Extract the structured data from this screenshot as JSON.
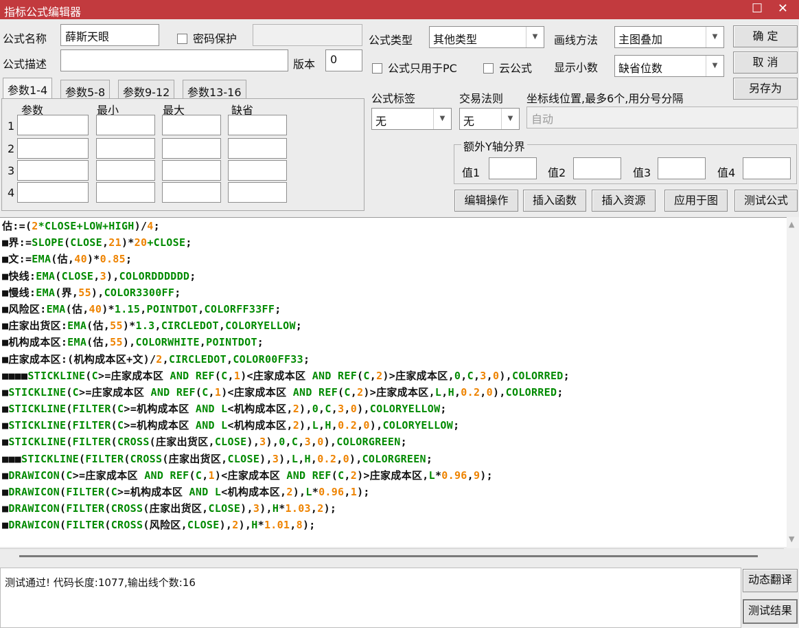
{
  "window": {
    "title": "指标公式编辑器",
    "controls": "☐ ✕"
  },
  "form": {
    "name_label": "公式名称",
    "name_value": "薛斯天眼",
    "password_label": "密码保护",
    "type_label": "公式类型",
    "type_value": "其他类型",
    "draw_label": "画线方法",
    "draw_value": "主图叠加",
    "desc_label": "公式描述",
    "desc_value": "",
    "version_label": "版本",
    "version_value": "0",
    "pc_only_label": "公式只用于PC",
    "cloud_label": "云公式",
    "decimals_label": "显示小数",
    "decimals_value": "缺省位数",
    "tag_label": "公式标签",
    "tag_value": "无",
    "rule_label": "交易法则",
    "rule_value": "无",
    "coord_label": "坐标线位置,最多6个,用分号分隔",
    "coord_placeholder": "自动",
    "yaxis_group": "额外Y轴分界",
    "y1": "值1",
    "y2": "值2",
    "y3": "值3",
    "y4": "值4"
  },
  "buttons": {
    "ok": "确  定",
    "cancel": "取  消",
    "save_as": "另存为",
    "edit_ops": "编辑操作",
    "insert_func": "插入函数",
    "insert_res": "插入资源",
    "apply": "应用于图",
    "test": "测试公式",
    "translate": "动态翻译",
    "test_result": "测试结果"
  },
  "tabs": [
    "参数1-4",
    "参数5-8",
    "参数9-12",
    "参数13-16"
  ],
  "params": {
    "headers": [
      "参数",
      "最小",
      "最大",
      "缺省"
    ],
    "rows": [
      "1",
      "2",
      "3",
      "4"
    ]
  },
  "code": [
    [
      [
        "b",
        "估:=("
      ],
      [
        "n",
        "2"
      ],
      [
        "k",
        "*CLOSE+LOW+HIGH"
      ],
      [
        "b",
        ")/"
      ],
      [
        "n",
        "4"
      ],
      [
        "b",
        ";"
      ]
    ],
    [
      [
        "b",
        "■界:="
      ],
      [
        "k",
        "SLOPE"
      ],
      [
        "b",
        "("
      ],
      [
        "k",
        "CLOSE"
      ],
      [
        "b",
        ","
      ],
      [
        "n",
        "21"
      ],
      [
        "b",
        ")*"
      ],
      [
        "n",
        "20"
      ],
      [
        "k",
        "+CLOSE"
      ],
      [
        "b",
        ";"
      ]
    ],
    [
      [
        "b",
        "■文:="
      ],
      [
        "k",
        "EMA"
      ],
      [
        "b",
        "(估,"
      ],
      [
        "n",
        "40"
      ],
      [
        "b",
        ")*"
      ],
      [
        "n",
        "0.85"
      ],
      [
        "b",
        ";"
      ]
    ],
    [
      [
        "b",
        "■快线:"
      ],
      [
        "k",
        "EMA"
      ],
      [
        "b",
        "("
      ],
      [
        "k",
        "CLOSE"
      ],
      [
        "b",
        ","
      ],
      [
        "n",
        "3"
      ],
      [
        "b",
        "),"
      ],
      [
        "k",
        "COLORDDDDDD"
      ],
      [
        "b",
        ";"
      ]
    ],
    [
      [
        "b",
        "■慢线:"
      ],
      [
        "k",
        "EMA"
      ],
      [
        "b",
        "(界,"
      ],
      [
        "n",
        "55"
      ],
      [
        "b",
        "),"
      ],
      [
        "k",
        "COLOR3300FF"
      ],
      [
        "b",
        ";"
      ]
    ],
    [
      [
        "b",
        "■风险区:"
      ],
      [
        "k",
        "EMA"
      ],
      [
        "b",
        "(估,"
      ],
      [
        "n",
        "40"
      ],
      [
        "b",
        ")*"
      ],
      [
        "k",
        "1.15"
      ],
      [
        "b",
        ","
      ],
      [
        "k",
        "POINTDOT"
      ],
      [
        "b",
        ","
      ],
      [
        "k",
        "COLORFF33FF"
      ],
      [
        "b",
        ";"
      ]
    ],
    [
      [
        "b",
        "■庄家出货区:"
      ],
      [
        "k",
        "EMA"
      ],
      [
        "b",
        "(估,"
      ],
      [
        "n",
        "55"
      ],
      [
        "b",
        ")*"
      ],
      [
        "k",
        "1.3"
      ],
      [
        "b",
        ","
      ],
      [
        "k",
        "CIRCLEDOT"
      ],
      [
        "b",
        ","
      ],
      [
        "k",
        "COLORYELLOW"
      ],
      [
        "b",
        ";"
      ]
    ],
    [
      [
        "b",
        "■机构成本区:"
      ],
      [
        "k",
        "EMA"
      ],
      [
        "b",
        "(估,"
      ],
      [
        "n",
        "55"
      ],
      [
        "b",
        "),"
      ],
      [
        "k",
        "COLORWHITE"
      ],
      [
        "b",
        ","
      ],
      [
        "k",
        "POINTDOT"
      ],
      [
        "b",
        ";"
      ]
    ],
    [
      [
        "b",
        "■庄家成本区:(机构成本区+文)/"
      ],
      [
        "n",
        "2"
      ],
      [
        "b",
        ","
      ],
      [
        "k",
        "CIRCLEDOT"
      ],
      [
        "b",
        ","
      ],
      [
        "k",
        "COLOR00FF33"
      ],
      [
        "b",
        ";"
      ]
    ],
    [
      [
        "b",
        "■■■■"
      ],
      [
        "k",
        "STICKLINE"
      ],
      [
        "b",
        "("
      ],
      [
        "k",
        "C"
      ],
      [
        "b",
        ">=庄家成本区 "
      ],
      [
        "k",
        "AND REF"
      ],
      [
        "b",
        "("
      ],
      [
        "k",
        "C"
      ],
      [
        "b",
        ","
      ],
      [
        "n",
        "1"
      ],
      [
        "b",
        ")<庄家成本区 "
      ],
      [
        "k",
        "AND REF"
      ],
      [
        "b",
        "("
      ],
      [
        "k",
        "C"
      ],
      [
        "b",
        ","
      ],
      [
        "n",
        "2"
      ],
      [
        "b",
        ")>庄家成本区,"
      ],
      [
        "k",
        "0"
      ],
      [
        "b",
        ","
      ],
      [
        "k",
        "C"
      ],
      [
        "b",
        ","
      ],
      [
        "n",
        "3"
      ],
      [
        "b",
        ","
      ],
      [
        "n",
        "0"
      ],
      [
        "b",
        "),"
      ],
      [
        "k",
        "COLORRED"
      ],
      [
        "b",
        ";"
      ]
    ],
    [
      [
        "b",
        "■"
      ],
      [
        "k",
        "STICKLINE"
      ],
      [
        "b",
        "("
      ],
      [
        "k",
        "C"
      ],
      [
        "b",
        ">=庄家成本区 "
      ],
      [
        "k",
        "AND REF"
      ],
      [
        "b",
        "("
      ],
      [
        "k",
        "C"
      ],
      [
        "b",
        ","
      ],
      [
        "n",
        "1"
      ],
      [
        "b",
        ")<庄家成本区 "
      ],
      [
        "k",
        "AND REF"
      ],
      [
        "b",
        "("
      ],
      [
        "k",
        "C"
      ],
      [
        "b",
        ","
      ],
      [
        "n",
        "2"
      ],
      [
        "b",
        ")>庄家成本区,"
      ],
      [
        "k",
        "L"
      ],
      [
        "b",
        ","
      ],
      [
        "k",
        "H"
      ],
      [
        "b",
        ","
      ],
      [
        "n",
        "0.2"
      ],
      [
        "b",
        ","
      ],
      [
        "n",
        "0"
      ],
      [
        "b",
        "),"
      ],
      [
        "k",
        "COLORRED"
      ],
      [
        "b",
        ";"
      ]
    ],
    [
      [
        "b",
        "■"
      ],
      [
        "k",
        "STICKLINE"
      ],
      [
        "b",
        "("
      ],
      [
        "k",
        "FILTER"
      ],
      [
        "b",
        "("
      ],
      [
        "k",
        "C"
      ],
      [
        "b",
        ">=机构成本区 "
      ],
      [
        "k",
        "AND L"
      ],
      [
        "b",
        "<机构成本区,"
      ],
      [
        "n",
        "2"
      ],
      [
        "b",
        "),"
      ],
      [
        "k",
        "0"
      ],
      [
        "b",
        ","
      ],
      [
        "k",
        "C"
      ],
      [
        "b",
        ","
      ],
      [
        "n",
        "3"
      ],
      [
        "b",
        ","
      ],
      [
        "n",
        "0"
      ],
      [
        "b",
        "),"
      ],
      [
        "k",
        "COLORYELLOW"
      ],
      [
        "b",
        ";"
      ]
    ],
    [
      [
        "b",
        "■"
      ],
      [
        "k",
        "STICKLINE"
      ],
      [
        "b",
        "("
      ],
      [
        "k",
        "FILTER"
      ],
      [
        "b",
        "("
      ],
      [
        "k",
        "C"
      ],
      [
        "b",
        ">=机构成本区 "
      ],
      [
        "k",
        "AND L"
      ],
      [
        "b",
        "<机构成本区,"
      ],
      [
        "n",
        "2"
      ],
      [
        "b",
        "),"
      ],
      [
        "k",
        "L"
      ],
      [
        "b",
        ","
      ],
      [
        "k",
        "H"
      ],
      [
        "b",
        ","
      ],
      [
        "n",
        "0.2"
      ],
      [
        "b",
        ","
      ],
      [
        "n",
        "0"
      ],
      [
        "b",
        "),"
      ],
      [
        "k",
        "COLORYELLOW"
      ],
      [
        "b",
        ";"
      ]
    ],
    [
      [
        "b",
        "■"
      ],
      [
        "k",
        "STICKLINE"
      ],
      [
        "b",
        "("
      ],
      [
        "k",
        "FILTER"
      ],
      [
        "b",
        "("
      ],
      [
        "k",
        "CROSS"
      ],
      [
        "b",
        "(庄家出货区,"
      ],
      [
        "k",
        "CLOSE"
      ],
      [
        "b",
        "),"
      ],
      [
        "n",
        "3"
      ],
      [
        "b",
        "),"
      ],
      [
        "k",
        "0"
      ],
      [
        "b",
        ","
      ],
      [
        "k",
        "C"
      ],
      [
        "b",
        ","
      ],
      [
        "n",
        "3"
      ],
      [
        "b",
        ","
      ],
      [
        "n",
        "0"
      ],
      [
        "b",
        "),"
      ],
      [
        "k",
        "COLORGREEN"
      ],
      [
        "b",
        ";"
      ]
    ],
    [
      [
        "b",
        "■■■"
      ],
      [
        "k",
        "STICKLINE"
      ],
      [
        "b",
        "("
      ],
      [
        "k",
        "FILTER"
      ],
      [
        "b",
        "("
      ],
      [
        "k",
        "CROSS"
      ],
      [
        "b",
        "(庄家出货区,"
      ],
      [
        "k",
        "CLOSE"
      ],
      [
        "b",
        "),"
      ],
      [
        "n",
        "3"
      ],
      [
        "b",
        "),"
      ],
      [
        "k",
        "L"
      ],
      [
        "b",
        ","
      ],
      [
        "k",
        "H"
      ],
      [
        "b",
        ","
      ],
      [
        "n",
        "0.2"
      ],
      [
        "b",
        ","
      ],
      [
        "n",
        "0"
      ],
      [
        "b",
        "),"
      ],
      [
        "k",
        "COLORGREEN"
      ],
      [
        "b",
        ";"
      ]
    ],
    [
      [
        "b",
        "■"
      ],
      [
        "k",
        "DRAWICON"
      ],
      [
        "b",
        "("
      ],
      [
        "k",
        "C"
      ],
      [
        "b",
        ">=庄家成本区 "
      ],
      [
        "k",
        "AND REF"
      ],
      [
        "b",
        "("
      ],
      [
        "k",
        "C"
      ],
      [
        "b",
        ","
      ],
      [
        "n",
        "1"
      ],
      [
        "b",
        ")<庄家成本区 "
      ],
      [
        "k",
        "AND REF"
      ],
      [
        "b",
        "("
      ],
      [
        "k",
        "C"
      ],
      [
        "b",
        ","
      ],
      [
        "n",
        "2"
      ],
      [
        "b",
        ")>庄家成本区,"
      ],
      [
        "k",
        "L"
      ],
      [
        "b",
        "*"
      ],
      [
        "n",
        "0.96"
      ],
      [
        "b",
        ","
      ],
      [
        "n",
        "9"
      ],
      [
        "b",
        ");"
      ]
    ],
    [
      [
        "b",
        "■"
      ],
      [
        "k",
        "DRAWICON"
      ],
      [
        "b",
        "("
      ],
      [
        "k",
        "FILTER"
      ],
      [
        "b",
        "("
      ],
      [
        "k",
        "C"
      ],
      [
        "b",
        ">=机构成本区 "
      ],
      [
        "k",
        "AND L"
      ],
      [
        "b",
        "<机构成本区,"
      ],
      [
        "n",
        "2"
      ],
      [
        "b",
        "),"
      ],
      [
        "k",
        "L"
      ],
      [
        "b",
        "*"
      ],
      [
        "n",
        "0.96"
      ],
      [
        "b",
        ","
      ],
      [
        "n",
        "1"
      ],
      [
        "b",
        ");"
      ]
    ],
    [
      [
        "b",
        "■"
      ],
      [
        "k",
        "DRAWICON"
      ],
      [
        "b",
        "("
      ],
      [
        "k",
        "FILTER"
      ],
      [
        "b",
        "("
      ],
      [
        "k",
        "CROSS"
      ],
      [
        "b",
        "(庄家出货区,"
      ],
      [
        "k",
        "CLOSE"
      ],
      [
        "b",
        "),"
      ],
      [
        "n",
        "3"
      ],
      [
        "b",
        "),"
      ],
      [
        "k",
        "H"
      ],
      [
        "b",
        "*"
      ],
      [
        "n",
        "1.03"
      ],
      [
        "b",
        ","
      ],
      [
        "n",
        "2"
      ],
      [
        "b",
        ");"
      ]
    ],
    [
      [
        "b",
        "■"
      ],
      [
        "k",
        "DRAWICON"
      ],
      [
        "b",
        "("
      ],
      [
        "k",
        "FILTER"
      ],
      [
        "b",
        "("
      ],
      [
        "k",
        "CROSS"
      ],
      [
        "b",
        "(风险区,"
      ],
      [
        "k",
        "CLOSE"
      ],
      [
        "b",
        "),"
      ],
      [
        "n",
        "2"
      ],
      [
        "b",
        "),"
      ],
      [
        "k",
        "H"
      ],
      [
        "b",
        "*"
      ],
      [
        "n",
        "1.01"
      ],
      [
        "b",
        ","
      ],
      [
        "n",
        "8"
      ],
      [
        "b",
        ");"
      ]
    ]
  ],
  "status": {
    "text": "测试通过! 代码长度:1077,输出线个数:16"
  }
}
